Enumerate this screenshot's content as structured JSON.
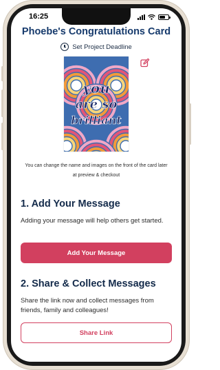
{
  "status_bar": {
    "time": "16:25",
    "battery_level": 0.7
  },
  "page": {
    "title": "Phoebe's Congratulations Card",
    "deadline_label": "Set Project Deadline",
    "card_text_lines": [
      "you",
      "are so",
      "brilliant"
    ],
    "helper_text": "You can change the name and images on the front of the card later at preview & checkout"
  },
  "section1": {
    "heading": "1. Add Your Message",
    "description": "Adding your message will help others get started.",
    "button_label": "Add Your Message"
  },
  "section2": {
    "heading": "2. Share & Collect Messages",
    "description": "Share the link now and collect messages from friends, family and colleagues!",
    "button_label": "Share Link"
  },
  "colors": {
    "title": "#163a6c",
    "accent": "#d2405f",
    "card_background": "#3e6db0",
    "rainbow": [
      "#f1a7c6",
      "#e25578",
      "#f29a3a",
      "#f7d57a",
      "#ffffff"
    ]
  },
  "icons": {
    "deadline": "clock-icon",
    "edit": "edit-pencil-icon"
  }
}
